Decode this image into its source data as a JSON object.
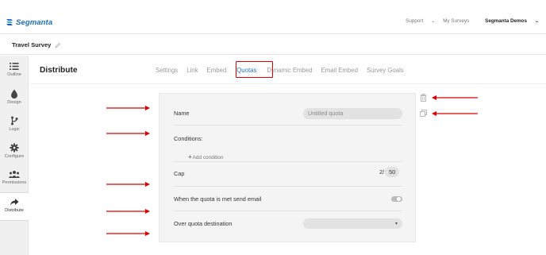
{
  "brand": {
    "name": "Segmanta"
  },
  "topnav": {
    "support": "Support",
    "my_surveys": "My Surveys",
    "account": "Segmanta Demos"
  },
  "survey": {
    "title": "Travel Survey"
  },
  "sidebar": {
    "items": [
      {
        "label": "Outline",
        "icon": "list-icon"
      },
      {
        "label": "Design",
        "icon": "droplet-icon"
      },
      {
        "label": "Logic",
        "icon": "branch-icon"
      },
      {
        "label": "Configure",
        "icon": "gear-icon"
      },
      {
        "label": "Permissions",
        "icon": "users-icon"
      },
      {
        "label": "Distribute",
        "icon": "share-arrow-icon"
      }
    ]
  },
  "page": {
    "title": "Distribute"
  },
  "tabs": [
    "Settings",
    "Link",
    "Embed",
    "Quotas",
    "Dynamic Embed",
    "Email Embed",
    "Survey Goals"
  ],
  "active_tab": "Quotas",
  "quota": {
    "name_label": "Name",
    "name_placeholder": "Untitled quota",
    "conditions_label": "Conditions:",
    "add_condition_label": "Add condition",
    "cap_label": "Cap",
    "cap_current": "2/",
    "cap_value": "50",
    "email_label": "When the quota is met send email",
    "email_enabled": false,
    "over_quota_label": "Over quota destination",
    "over_quota_value": ""
  },
  "colors": {
    "accent": "#2a74c7",
    "highlight": "#e00000"
  }
}
